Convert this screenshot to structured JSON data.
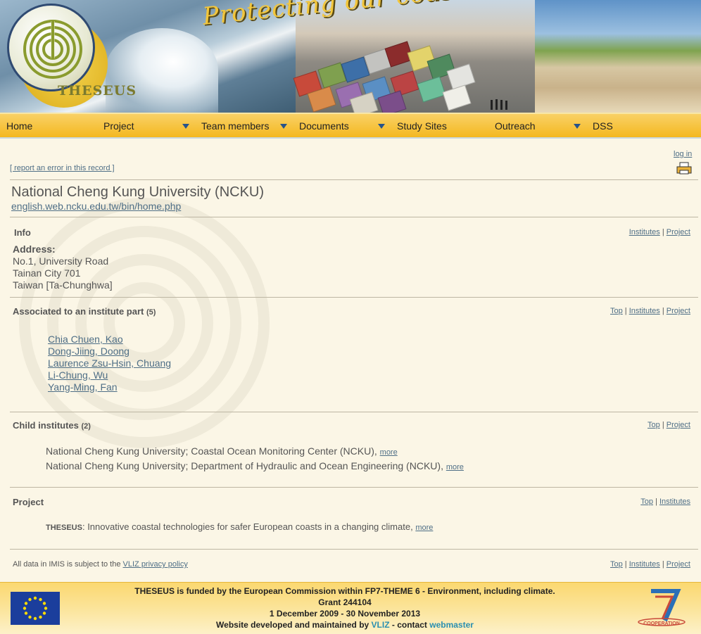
{
  "header": {
    "logo_text": "THESEUS",
    "slogan": "Protecting our coasts"
  },
  "nav": {
    "items": [
      {
        "label": "Home",
        "dropdown": false
      },
      {
        "label": "Project",
        "dropdown": true
      },
      {
        "label": "Team members",
        "dropdown": true
      },
      {
        "label": "Documents",
        "dropdown": true
      },
      {
        "label": "Study Sites",
        "dropdown": false
      },
      {
        "label": "Outreach",
        "dropdown": true
      },
      {
        "label": "DSS",
        "dropdown": false
      }
    ]
  },
  "toolbar": {
    "report_error": "[ report an error in this record ]",
    "login": "log in",
    "print_icon": "printer-icon"
  },
  "record": {
    "title": "National Cheng Kung University (NCKU)",
    "url": "english.web.ncku.edu.tw/bin/home.php"
  },
  "info": {
    "heading": "Info",
    "address_label": "Address:",
    "address_lines": [
      "No.1, University Road",
      "Tainan City 701",
      "Taiwan [Ta-Chunghwa]"
    ],
    "links": [
      "Institutes",
      "Project"
    ]
  },
  "associated": {
    "heading": "Associated to an institute part",
    "count": "(5)",
    "links": [
      "Top",
      "Institutes",
      "Project"
    ],
    "people": [
      "Chia Chuen, Kao",
      "Dong-Jiing, Doong",
      "Laurence Zsu-Hsin, Chuang",
      "Li-Chung, Wu",
      "Yang-Ming, Fan"
    ]
  },
  "child_institutes": {
    "heading": "Child institutes",
    "count": "(2)",
    "links": [
      "Top",
      "Project"
    ],
    "items": [
      {
        "name": "National Cheng Kung University; Coastal Ocean Monitoring Center (NCKU)",
        "more": "more"
      },
      {
        "name": "National Cheng Kung University; Department of Hydraulic and Ocean Engineering (NCKU)",
        "more": "more"
      }
    ]
  },
  "project": {
    "heading": "Project",
    "links": [
      "Top",
      "Institutes"
    ],
    "acronym": "THESEUS",
    "description": ": Innovative coastal technologies for safer European coasts in a changing climate,",
    "more": "more"
  },
  "bottom": {
    "text": "All data in IMIS is subject to the",
    "policy_link": "VLIZ privacy policy",
    "links": [
      "Top",
      "Institutes",
      "Project"
    ]
  },
  "footer": {
    "line1": "THESEUS is funded by the European Commission within FP7-THEME 6 - Environment, including climate.",
    "line2": "Grant 244104",
    "line3": "1 December 2009 - 30 November 2013",
    "line4_prefix": "Website developed and maintained by",
    "vliz": "VLIZ",
    "contact": "- contact",
    "webmaster": "webmaster",
    "fp7_label": "COOPERATION",
    "colors": {
      "accent": "#f4b820",
      "link": "#4e6e86",
      "footer_link": "#2a8fb0"
    }
  }
}
